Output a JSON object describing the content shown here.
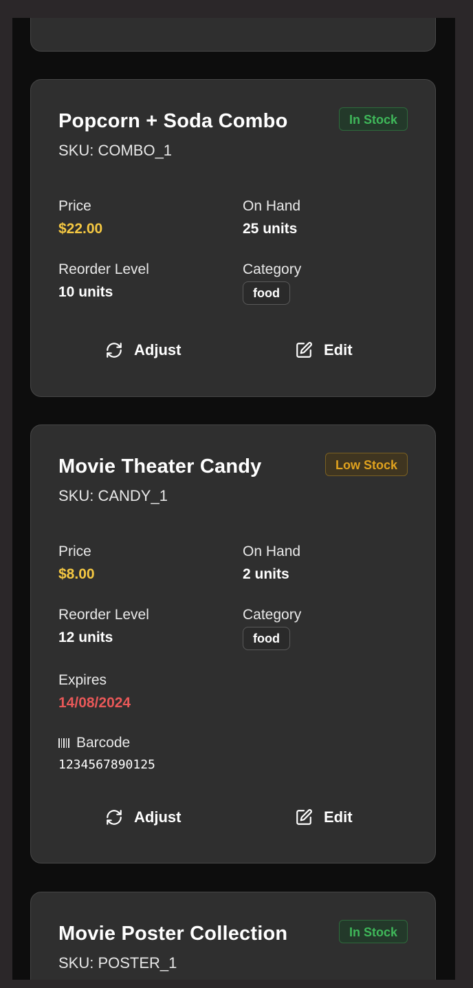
{
  "products": [
    {
      "name": "Popcorn + Soda Combo",
      "sku": "SKU: COMBO_1",
      "status": "In Stock",
      "price_label": "Price",
      "price": "$22.00",
      "on_hand_label": "On Hand",
      "on_hand": "25 units",
      "reorder_label": "Reorder Level",
      "reorder": "10 units",
      "category_label": "Category",
      "category": "food",
      "adjust_label": "Adjust",
      "edit_label": "Edit"
    },
    {
      "name": "Movie Theater Candy",
      "sku": "SKU: CANDY_1",
      "status": "Low Stock",
      "price_label": "Price",
      "price": "$8.00",
      "on_hand_label": "On Hand",
      "on_hand": "2 units",
      "reorder_label": "Reorder Level",
      "reorder": "12 units",
      "category_label": "Category",
      "category": "food",
      "expires_label": "Expires",
      "expires": "14/08/2024",
      "barcode_label": "Barcode",
      "barcode": "1234567890125",
      "adjust_label": "Adjust",
      "edit_label": "Edit"
    },
    {
      "name": "Movie Poster Collection",
      "sku": "SKU: POSTER_1",
      "status": "In Stock"
    }
  ],
  "colors": {
    "price": "#f5c842",
    "expires": "#e85858",
    "in_stock": "#3fb85a",
    "low_stock": "#e0a21e"
  },
  "icons": {
    "adjust": "refresh-icon",
    "edit": "edit-icon",
    "barcode": "barcode-icon"
  }
}
